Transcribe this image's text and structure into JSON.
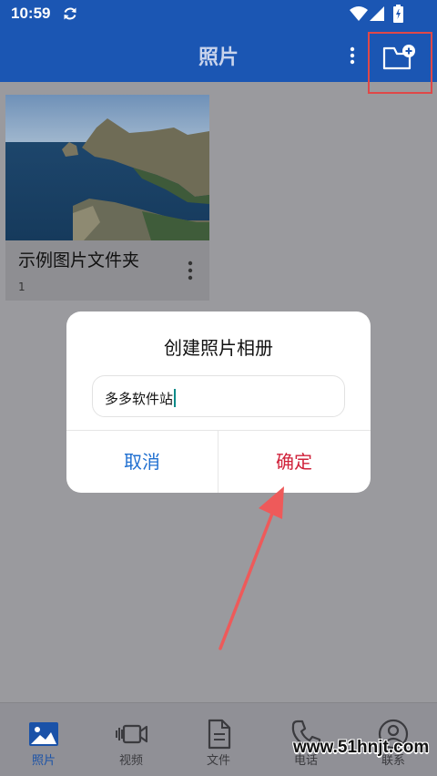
{
  "status_bar": {
    "time": "10:59"
  },
  "app_bar": {
    "title": "照片"
  },
  "albums": [
    {
      "name": "示例图片文件夹",
      "count": "1"
    }
  ],
  "dialog": {
    "title": "创建照片相册",
    "input_value": "多多软件站",
    "cancel_label": "取消",
    "confirm_label": "确定"
  },
  "bottom_nav": {
    "photos": "照片",
    "videos": "视频",
    "files": "文件",
    "phone": "电话",
    "contacts": "联系"
  },
  "watermark": "www.51hnjt.com",
  "colors": {
    "primary": "#1b56b3",
    "confirm": "#d0213a",
    "cancel": "#1f6fd0",
    "highlight": "#e04848"
  }
}
